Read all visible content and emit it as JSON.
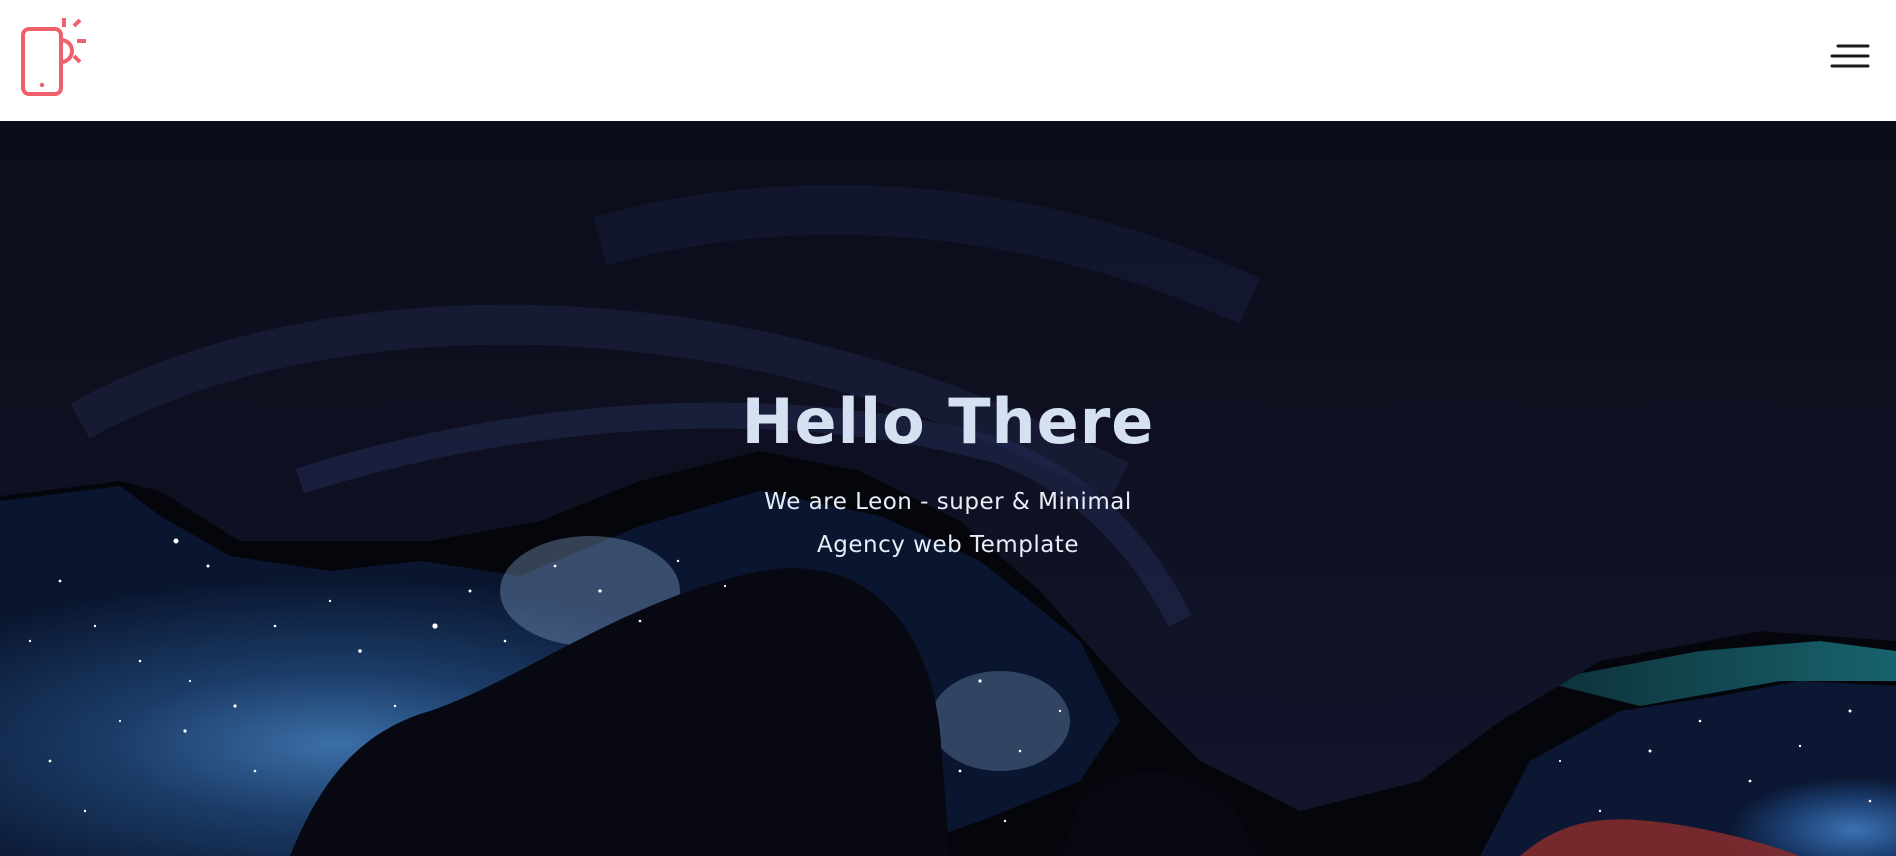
{
  "header": {
    "logo_icon": "phone-sun-icon",
    "menu_icon": "hamburger-menu-icon",
    "accent_color": "#f0606a"
  },
  "hero": {
    "title": "Hello There",
    "subtitle_line1": "We are Leon - super & Minimal",
    "subtitle_line2": "Agency web Template"
  }
}
